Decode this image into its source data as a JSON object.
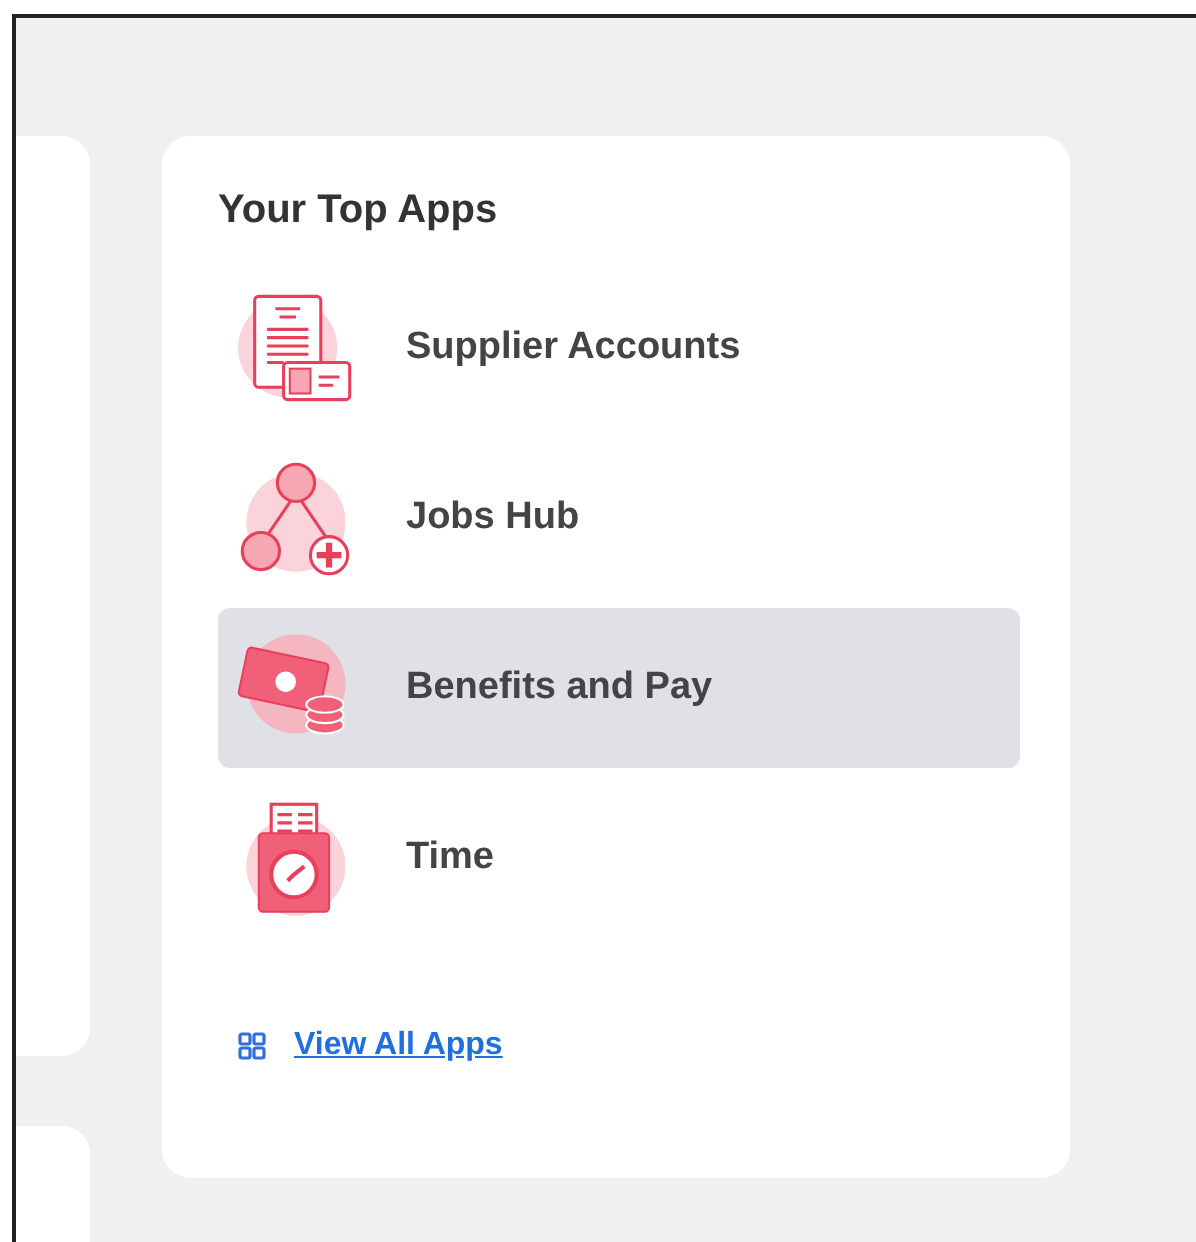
{
  "card": {
    "title": "Your Top Apps",
    "apps": [
      {
        "kind": "supplier",
        "label": "Supplier Accounts",
        "selected": false
      },
      {
        "kind": "jobs",
        "label": "Jobs Hub",
        "selected": false
      },
      {
        "kind": "pay",
        "label": "Benefits and Pay",
        "selected": true
      },
      {
        "kind": "time",
        "label": "Time",
        "selected": false
      }
    ],
    "link": "View All Apps"
  }
}
